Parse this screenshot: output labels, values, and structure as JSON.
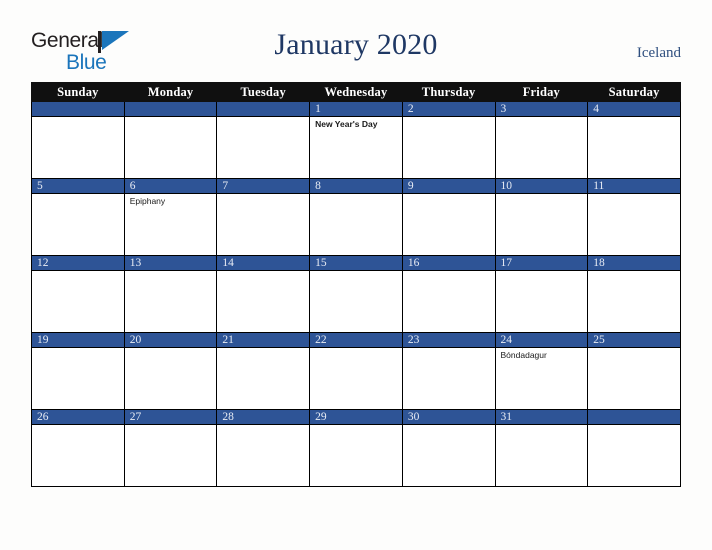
{
  "brand": {
    "line1": "General",
    "line2": "Blue",
    "mark": "triangle-logo-icon",
    "color_dark": "#231f20",
    "color_blue": "#1b75bb"
  },
  "header": {
    "title": "January 2020",
    "region": "Iceland",
    "title_color": "#1f3864",
    "region_color": "#2f4f7f"
  },
  "calendar": {
    "weekday_headers": [
      "Sunday",
      "Monday",
      "Tuesday",
      "Wednesday",
      "Thursday",
      "Friday",
      "Saturday"
    ],
    "header_bg": "#101010",
    "daybar_bg": "#2e5496",
    "daybar_text": "#e8ecf4",
    "weeks": [
      [
        {
          "day": "",
          "events": []
        },
        {
          "day": "",
          "events": []
        },
        {
          "day": "",
          "events": []
        },
        {
          "day": "1",
          "events": [
            {
              "label": "New Year's Day",
              "bold": true
            }
          ]
        },
        {
          "day": "2",
          "events": []
        },
        {
          "day": "3",
          "events": []
        },
        {
          "day": "4",
          "events": []
        }
      ],
      [
        {
          "day": "5",
          "events": []
        },
        {
          "day": "6",
          "events": [
            {
              "label": "Epiphany",
              "bold": false
            }
          ]
        },
        {
          "day": "7",
          "events": []
        },
        {
          "day": "8",
          "events": []
        },
        {
          "day": "9",
          "events": []
        },
        {
          "day": "10",
          "events": []
        },
        {
          "day": "11",
          "events": []
        }
      ],
      [
        {
          "day": "12",
          "events": []
        },
        {
          "day": "13",
          "events": []
        },
        {
          "day": "14",
          "events": []
        },
        {
          "day": "15",
          "events": []
        },
        {
          "day": "16",
          "events": []
        },
        {
          "day": "17",
          "events": []
        },
        {
          "day": "18",
          "events": []
        }
      ],
      [
        {
          "day": "19",
          "events": []
        },
        {
          "day": "20",
          "events": []
        },
        {
          "day": "21",
          "events": []
        },
        {
          "day": "22",
          "events": []
        },
        {
          "day": "23",
          "events": []
        },
        {
          "day": "24",
          "events": [
            {
              "label": "Bóndadagur",
              "bold": false
            }
          ]
        },
        {
          "day": "25",
          "events": []
        }
      ],
      [
        {
          "day": "26",
          "events": []
        },
        {
          "day": "27",
          "events": []
        },
        {
          "day": "28",
          "events": []
        },
        {
          "day": "29",
          "events": []
        },
        {
          "day": "30",
          "events": []
        },
        {
          "day": "31",
          "events": []
        },
        {
          "day": "",
          "events": []
        }
      ]
    ]
  }
}
